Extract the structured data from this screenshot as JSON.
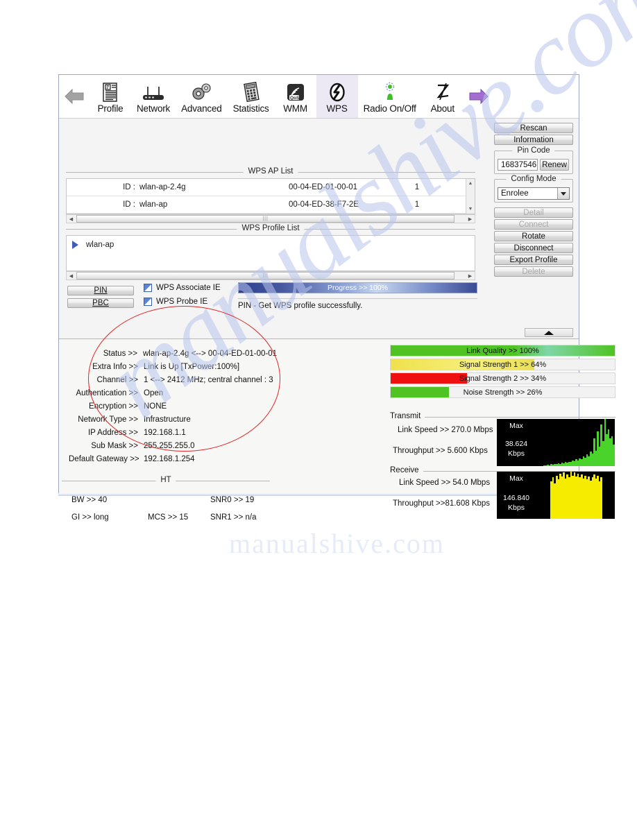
{
  "toolbar": {
    "back_icon": "left-arrow-icon",
    "forward_icon": "right-arrow-icon",
    "tabs": [
      {
        "label": "Profile",
        "icon": "profile-icon"
      },
      {
        "label": "Network",
        "icon": "router-icon"
      },
      {
        "label": "Advanced",
        "icon": "gears-icon"
      },
      {
        "label": "Statistics",
        "icon": "calculator-icon"
      },
      {
        "label": "WMM",
        "icon": "qos-icon"
      },
      {
        "label": "WPS",
        "icon": "wps-icon"
      },
      {
        "label": "Radio On/Off",
        "icon": "antenna-icon"
      },
      {
        "label": "About",
        "icon": "signature-icon"
      }
    ],
    "active_tab": "WPS"
  },
  "ap_list": {
    "title": "WPS AP List",
    "rows": [
      {
        "id_label": "ID :",
        "ssid": "wlan-ap-2.4g",
        "mac": "00-04-ED-01-00-01",
        "channel": "1"
      },
      {
        "id_label": "ID :",
        "ssid": "wlan-ap",
        "mac": "00-04-ED-38-F7-2E",
        "channel": "1"
      }
    ]
  },
  "profile_list": {
    "title": "WPS Profile List",
    "rows": [
      {
        "name": "wlan-ap"
      }
    ]
  },
  "actions": {
    "pin_label": "PIN",
    "pbc_label": "PBC",
    "checkboxes": [
      {
        "label": "WPS Associate IE",
        "checked": true
      },
      {
        "label": "WPS Probe IE",
        "checked": true
      }
    ],
    "progress_text": "Progress >> 100%",
    "progress_value": 100,
    "status_message": "PIN - Get WPS profile successfully."
  },
  "side_panel": {
    "rescan_label": "Rescan",
    "information_label": "Information",
    "pin_code_group": "Pin Code",
    "pin_code_value": "16837546",
    "renew_label": "Renew",
    "config_mode_group": "Config Mode",
    "config_mode_value": "Enrolee",
    "buttons": [
      {
        "label": "Detail",
        "disabled": true
      },
      {
        "label": "Connect",
        "disabled": true
      },
      {
        "label": "Rotate",
        "disabled": false
      },
      {
        "label": "Disconnect",
        "disabled": false
      },
      {
        "label": "Export Profile",
        "disabled": false
      },
      {
        "label": "Delete",
        "disabled": true
      }
    ]
  },
  "status": {
    "rows": [
      {
        "label": "Status >>",
        "value": "wlan-ap-2.4g    <-->  00-04-ED-01-00-01"
      },
      {
        "label": "Extra Info >>",
        "value": "Link is Up [TxPower:100%]"
      },
      {
        "label": "Channel >>",
        "value": "1 <--> 2412 MHz; central channel : 3"
      },
      {
        "label": "Authentication >>",
        "value": "Open"
      },
      {
        "label": "Encryption >>",
        "value": "NONE"
      },
      {
        "label": "Network Type >>",
        "value": "Infrastructure"
      },
      {
        "label": "IP Address >>",
        "value": "192.168.1.1"
      },
      {
        "label": "Sub Mask >>",
        "value": "255.255.255.0"
      },
      {
        "label": "Default Gateway >>",
        "value": "192.168.1.254"
      }
    ]
  },
  "ht": {
    "title": "HT",
    "bw": "BW >> 40",
    "gi": "GI >> long",
    "mcs": "MCS >>   15",
    "snr0": "SNR0 >>   19",
    "snr1": "SNR1 >>  n/a"
  },
  "meters": [
    {
      "label": "Link Quality >> 100%",
      "value": 100,
      "color": "#4fc323"
    },
    {
      "label": "Signal Strength 1 >> 64%",
      "value": 64,
      "color": "#f2e85c"
    },
    {
      "label": "Signal Strength 2 >> 34%",
      "value": 34,
      "color": "#ef1010"
    },
    {
      "label": "Noise Strength >> 26%",
      "value": 26,
      "color": "#4fc323"
    }
  ],
  "transmit": {
    "caption": "Transmit",
    "link_speed": "Link Speed >>  270.0 Mbps",
    "throughput": "Throughput >> 5.600 Kbps",
    "graph_max_label": "Max",
    "graph_value": "38.624",
    "graph_unit": "Kbps",
    "graph_color": "#4ad32a"
  },
  "receive": {
    "caption": "Receive",
    "link_speed": "Link Speed >> 54.0 Mbps",
    "throughput": "Throughput >>81.608 Kbps",
    "graph_max_label": "Max",
    "graph_value": "146.840",
    "graph_unit": "Kbps",
    "graph_color": "#f5ec00"
  },
  "chart_data": [
    {
      "type": "bar",
      "title": "Transmit throughput history",
      "ylabel": "Kbps",
      "ymax_label": "38.624",
      "values": [
        0,
        0,
        0,
        0,
        0,
        2,
        1,
        3,
        2,
        4,
        3,
        5,
        4,
        6,
        5,
        7,
        6,
        8,
        7,
        9,
        8,
        12,
        10,
        14,
        12,
        16,
        14,
        20,
        17,
        24,
        20,
        30,
        26,
        58,
        32,
        72,
        40,
        86,
        52,
        98,
        66,
        76,
        58,
        62,
        44
      ]
    },
    {
      "type": "bar",
      "title": "Receive throughput history",
      "ylabel": "Kbps",
      "ymax_label": "146.840",
      "values": [
        0,
        0,
        0,
        0,
        0,
        0,
        0,
        0,
        0,
        78,
        86,
        74,
        90,
        82,
        94,
        88,
        96,
        84,
        92,
        86,
        98,
        90,
        96,
        88,
        94,
        86,
        92,
        84,
        90,
        82,
        88,
        80,
        86,
        92,
        84,
        90,
        78,
        86,
        0,
        0,
        0,
        0,
        0,
        0,
        0
      ]
    }
  ],
  "watermark": {
    "text": "manualshive.com",
    "faded_text": "manualshive.com"
  }
}
